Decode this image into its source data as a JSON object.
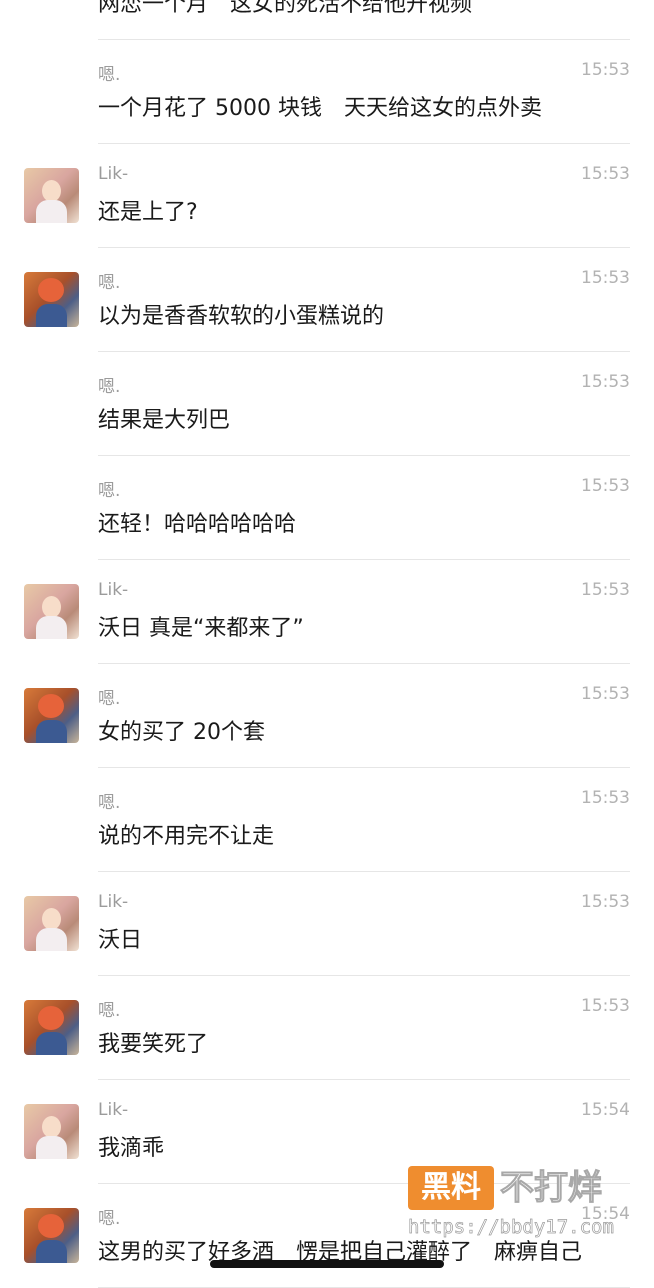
{
  "messages": [
    {
      "avatar": "none",
      "name": "",
      "time": "",
      "text": "网恋一个月　这女的死活不给他开视频"
    },
    {
      "avatar": "none",
      "name": "嗯.",
      "time": "15:53",
      "text": "一个月花了 5000 块钱　天天给这女的点外卖"
    },
    {
      "avatar": "lik",
      "name": "Lik-",
      "time": "15:53",
      "text": "还是上了?"
    },
    {
      "avatar": "en",
      "name": "嗯.",
      "time": "15:53",
      "text": "以为是香香软软的小蛋糕说的"
    },
    {
      "avatar": "none",
      "name": "嗯.",
      "time": "15:53",
      "text": "结果是大列巴"
    },
    {
      "avatar": "none",
      "name": "嗯.",
      "time": "15:53",
      "text": "还轻！哈哈哈哈哈哈"
    },
    {
      "avatar": "lik",
      "name": "Lik-",
      "time": "15:53",
      "text": "沃日 真是“来都来了”"
    },
    {
      "avatar": "en",
      "name": "嗯.",
      "time": "15:53",
      "text": "女的买了 20个套"
    },
    {
      "avatar": "none",
      "name": "嗯.",
      "time": "15:53",
      "text": "说的不用完不让走"
    },
    {
      "avatar": "lik",
      "name": "Lik-",
      "time": "15:53",
      "text": "沃日"
    },
    {
      "avatar": "en",
      "name": "嗯.",
      "time": "15:53",
      "text": "我要笑死了"
    },
    {
      "avatar": "lik",
      "name": "Lik-",
      "time": "15:54",
      "text": "我滴乖"
    },
    {
      "avatar": "en",
      "name": "嗯.",
      "time": "15:54",
      "text": "这男的买了好多酒　愣是把自己灌醉了　麻痹自己"
    }
  ],
  "watermark": {
    "badge": "黑料",
    "title": "不打烊",
    "url": "https://bbdy17.com"
  }
}
